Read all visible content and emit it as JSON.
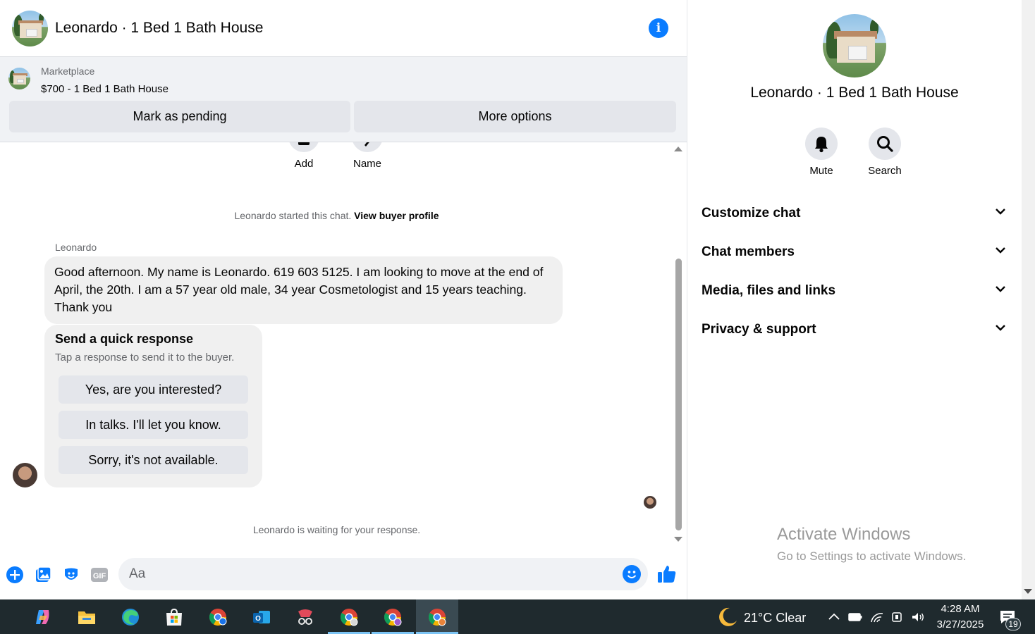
{
  "chat_header": {
    "title": "Leonardo · 1 Bed 1 Bath House",
    "info_icon": "info-icon"
  },
  "listing": {
    "source": "Marketplace",
    "name": "$700 - 1 Bed 1 Bath House",
    "mark_pending_label": "Mark as pending",
    "more_options_label": "More options"
  },
  "top_actions": [
    {
      "label": "Add",
      "icon": "add-person-icon"
    },
    {
      "label": "Name",
      "icon": "pencil-icon"
    }
  ],
  "messages": {
    "started_text": "Leonardo started this chat.",
    "view_profile_link": "View buyer profile",
    "sender_name": "Leonardo",
    "message_text": "Good afternoon.  My name is Leonardo.  619 603 5125.  I am looking to move at the end of April, the 20th. I am a 57 year old male, 34 year Cosmetologist and 15 years teaching. Thank you",
    "quick_response_title": "Send a quick response",
    "quick_response_subtitle": "Tap a response to send it to the buyer.",
    "quick_responses": [
      "Yes, are you interested?",
      "In talks. I'll let you know.",
      "Sorry, it's not available."
    ],
    "waiting_text": "Leonardo is waiting for your response."
  },
  "composer": {
    "placeholder": "Aa",
    "icons": [
      "plus-icon",
      "photo-icon",
      "sticker-icon",
      "gif-icon",
      "emoji-icon",
      "like-icon"
    ]
  },
  "info_panel": {
    "title": "Leonardo · 1 Bed 1 Bath House",
    "actions": [
      {
        "label": "Mute",
        "icon": "bell-icon"
      },
      {
        "label": "Search",
        "icon": "search-icon"
      }
    ],
    "sections": [
      "Customize chat",
      "Chat members",
      "Media, files and links",
      "Privacy & support"
    ]
  },
  "watermark": {
    "line1": "Activate Windows",
    "line2": "Go to Settings to activate Windows."
  },
  "taskbar": {
    "apps": [
      "copilot-icon",
      "file-explorer-icon",
      "edge-icon",
      "store-icon",
      "chrome-icon",
      "outlook-icon",
      "snipping-tool-icon",
      "chrome-profile-1-icon",
      "chrome-profile-2-icon",
      "chrome-profile-3-icon"
    ],
    "weather": "21°C  Clear",
    "time": "4:28 AM",
    "date": "3/27/2025",
    "notification_count": "19"
  },
  "colors": {
    "accent": "#0a7cff",
    "bubble": "#f0f0f0",
    "button_gray": "#e4e6eb",
    "taskbar": "#1f2a2e"
  }
}
